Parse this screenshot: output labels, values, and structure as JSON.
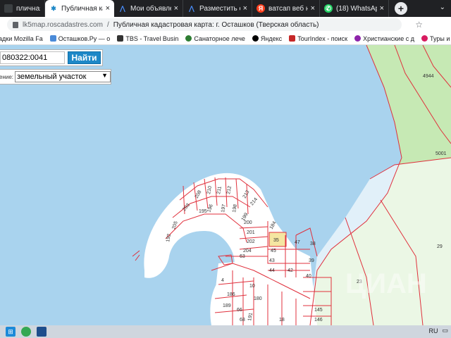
{
  "browser": {
    "tabs": [
      {
        "label": "пличная кадастр",
        "icon": "rosreestr-icon",
        "color": "#e8eaed",
        "active": false
      },
      {
        "label": "Публичная кадас",
        "icon": "map-icon",
        "color": "#1e88c7",
        "active": true
      },
      {
        "label": "Мои объявления",
        "icon": "cian-icon",
        "color": "#0468ff",
        "active": false
      },
      {
        "label": "Разместить объяв",
        "icon": "cian-icon",
        "color": "#0468ff",
        "active": false
      },
      {
        "label": "ватсап веб на ком",
        "icon": "yandex-icon",
        "color": "#fc3f1d",
        "active": false
      },
      {
        "label": "(18) WhatsApp",
        "icon": "whatsapp-icon",
        "color": "#25d366",
        "active": false
      }
    ],
    "new_tab": "+",
    "address": {
      "url": "lk5map.roscadastres.com",
      "separator": "/",
      "title": "Публичная кадастровая карта: г. Осташков (Тверская область)"
    },
    "bookmarks": [
      {
        "label": "адки Mozilla Fa",
        "color": "#e66000"
      },
      {
        "label": "Осташков.Ру — о",
        "color": "#4a8ad8"
      },
      {
        "label": "TBS - Travel Busin",
        "color": "#333333"
      },
      {
        "label": "Санаторное лече",
        "color": "#2e7d32"
      },
      {
        "label": "Яндекс",
        "color": "#000000"
      },
      {
        "label": "TourIndex - поиск",
        "color": "#c62828"
      },
      {
        "label": "Христианские с д",
        "color": "#8e24aa"
      },
      {
        "label": "Туры и о",
        "color": "#d81b60"
      }
    ]
  },
  "search": {
    "cad_number": "080322:0041",
    "find_label": "Найти",
    "type_label": "ение:",
    "type_value": "земельный участок"
  },
  "map": {
    "colors": {
      "water": "#a9d3ee",
      "green": "#c6e9b4",
      "land": "#ffffff",
      "boundary": "#e0303c",
      "highlight": "#f5e6a1"
    },
    "parcel_labels": [
      "205",
      "203",
      "208",
      "210",
      "212",
      "211",
      "213",
      "214",
      "195",
      "196",
      "197",
      "198",
      "199",
      "192",
      "200",
      "201",
      "202",
      "204",
      "35",
      "184",
      "47",
      "45",
      "43",
      "42",
      "38",
      "39",
      "44",
      "40",
      "63",
      "10",
      "4",
      "186",
      "180",
      "66",
      "68",
      "189",
      "191",
      "18",
      "145",
      "146",
      "23",
      "29",
      "4944",
      "5001"
    ],
    "watermark": "ЦИАН"
  },
  "taskbar": {
    "items": [
      {
        "name": "start-icon",
        "color": "#1c8ad8"
      },
      {
        "name": "chrome-icon",
        "color": "#34a853"
      },
      {
        "name": "files-icon",
        "color": "#1e4e8c"
      }
    ],
    "language": "RU"
  }
}
